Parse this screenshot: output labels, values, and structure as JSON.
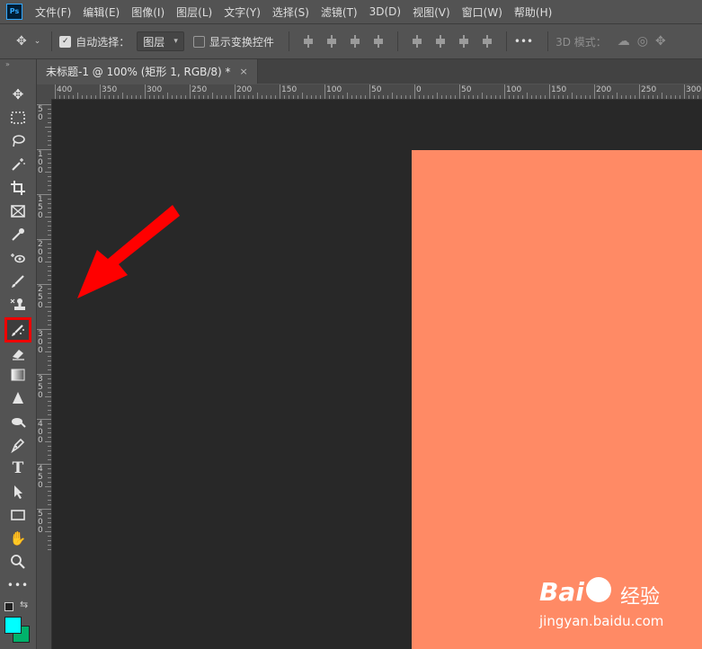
{
  "app": {
    "logo_text": "Ps"
  },
  "menu": [
    "文件(F)",
    "编辑(E)",
    "图像(I)",
    "图层(L)",
    "文字(Y)",
    "选择(S)",
    "滤镜(T)",
    "3D(D)",
    "视图(V)",
    "窗口(W)",
    "帮助(H)"
  ],
  "options": {
    "auto_select_label": "自动选择：",
    "auto_select_checked": true,
    "layer_dropdown_value": "图层",
    "show_transform_label": "显示变换控件",
    "more_label": "•••",
    "mode_3d_label": "3D 模式："
  },
  "document": {
    "tab_title": "未标题-1 @ 100% (矩形 1, RGB/8) *",
    "close_symbol": "×"
  },
  "ruler": {
    "h_labels": [
      "400",
      "350",
      "300",
      "250",
      "200",
      "150",
      "100",
      "50",
      "0",
      "50",
      "100",
      "150",
      "200",
      "250",
      "300"
    ],
    "v_labels": [
      "5\n0",
      "1\n0\n0",
      "1\n5\n0",
      "2\n0\n0",
      "2\n5\n0",
      "3\n0\n0",
      "3\n5\n0",
      "4\n0\n0",
      "4\n5\n0",
      "5\n0\n0"
    ]
  },
  "colors": {
    "artboard": "#ff8a65",
    "canvas_bg": "#282828",
    "foreground": "#00ffff",
    "background": "#00b26b",
    "highlight": "#e00000"
  },
  "tools": [
    "move-tool",
    "marquee-tool",
    "lasso-tool",
    "magic-wand-tool",
    "crop-tool",
    "frame-tool",
    "eyedropper-tool",
    "spot-healing-tool",
    "brush-tool",
    "clone-stamp-tool",
    "history-brush-tool",
    "eraser-tool",
    "gradient-tool",
    "blur-tool",
    "dodge-tool",
    "pen-tool",
    "type-tool",
    "path-selection-tool",
    "rectangle-tool",
    "hand-tool",
    "zoom-tool",
    "more-tools"
  ],
  "watermark": {
    "brand": "Bai",
    "brand2": "经验",
    "url": "jingyan.baidu.com"
  }
}
